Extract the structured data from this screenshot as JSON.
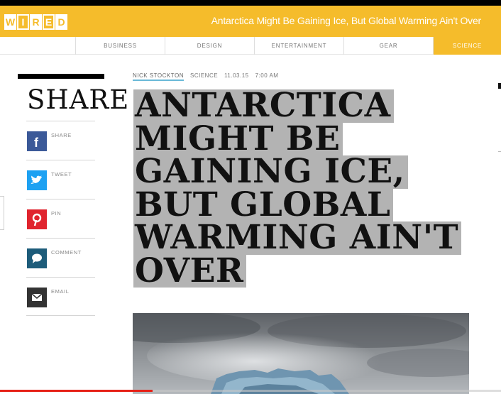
{
  "header": {
    "logo_letters": [
      "W",
      "I",
      "R",
      "E",
      "D"
    ],
    "title": "Antarctica Might Be Gaining Ice, But Global Warming Ain't Over",
    "brand_color": "#f5bc2b"
  },
  "nav": {
    "items": [
      {
        "label": "BUSINESS"
      },
      {
        "label": "DESIGN"
      },
      {
        "label": "ENTERTAINMENT"
      },
      {
        "label": "GEAR"
      },
      {
        "label": "SCIENCE",
        "active": true
      }
    ]
  },
  "share": {
    "heading": "SHARE",
    "items": [
      {
        "label": "SHARE",
        "icon": "facebook-icon",
        "color": "#3b5998"
      },
      {
        "label": "TWEET",
        "icon": "twitter-icon",
        "color": "#1da1f2"
      },
      {
        "label": "PIN",
        "icon": "pinterest-icon",
        "color": "#e0242e"
      },
      {
        "label": "COMMENT",
        "icon": "comment-icon",
        "color": "#1d5c7a"
      },
      {
        "label": "EMAIL",
        "icon": "email-icon",
        "color": "#333333"
      }
    ]
  },
  "article": {
    "author": "NICK STOCKTON",
    "section": "SCIENCE",
    "date": "11.03.15",
    "time": "7:00 AM",
    "headline_lines": [
      "ANTARCTICA",
      "MIGHT BE",
      "GAINING ICE,",
      "BUT GLOBAL",
      "WARMING AIN'T",
      "OVER"
    ]
  },
  "video": {
    "progress": 0.305
  }
}
